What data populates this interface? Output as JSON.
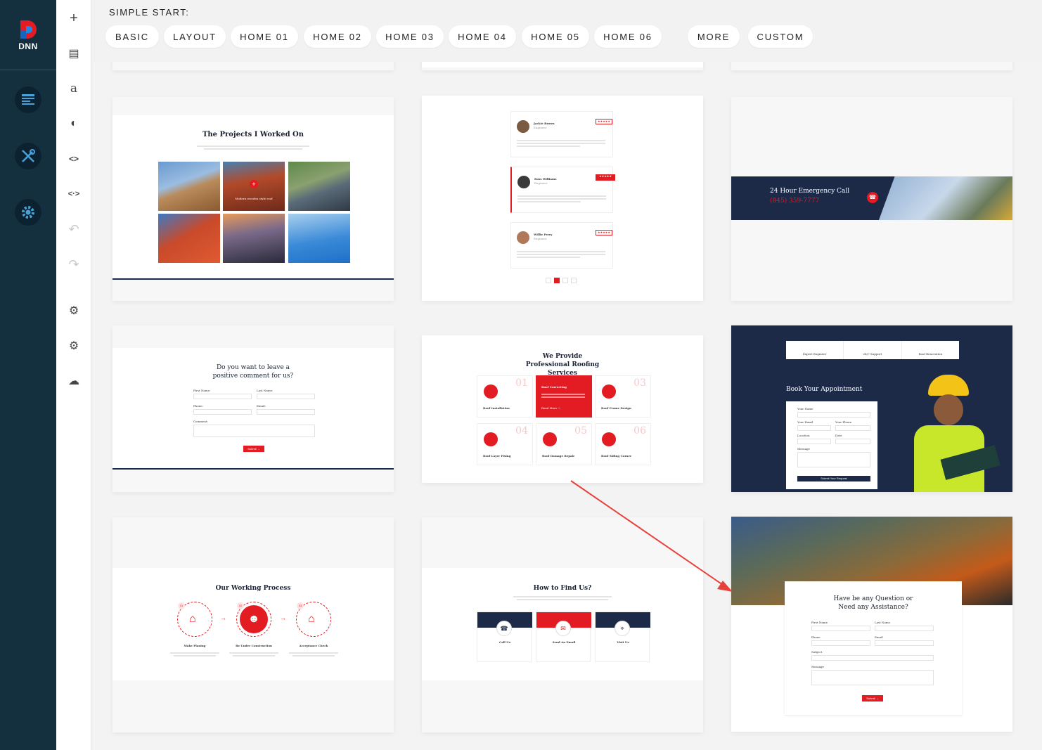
{
  "brand": {
    "logo_text": "DNN",
    "accent": "#e31b23",
    "blue": "#1565c0"
  },
  "sidebar": {
    "items": [
      {
        "icon": "page-icon"
      },
      {
        "icon": "tools-icon"
      },
      {
        "icon": "gear-icon"
      }
    ]
  },
  "toolbar": {
    "items": [
      {
        "icon": "plus-icon",
        "glyph": "+"
      },
      {
        "icon": "document-icon",
        "glyph": "▤"
      },
      {
        "icon": "font-icon",
        "glyph": "a"
      },
      {
        "icon": "contrast-icon",
        "glyph": "◐"
      },
      {
        "icon": "code-icon",
        "glyph": "<>"
      },
      {
        "icon": "resize-icon",
        "glyph": "<·>"
      },
      {
        "icon": "undo-icon",
        "glyph": "↶"
      },
      {
        "icon": "redo-icon",
        "glyph": "↷"
      },
      {
        "icon": "cogs-icon",
        "glyph": "⚙"
      },
      {
        "icon": "settings-icon",
        "glyph": "⚙"
      },
      {
        "icon": "cloud-download-icon",
        "glyph": "☁"
      }
    ]
  },
  "header": {
    "title": "SIMPLE START:",
    "categories": [
      "BASIC",
      "LAYOUT",
      "HOME 01",
      "HOME 02",
      "HOME 03",
      "HOME 04",
      "HOME 05",
      "HOME 06",
      "MORE",
      "CUSTOM"
    ]
  },
  "templates": {
    "projects": {
      "title": "The Projects I Worked On",
      "overlay": "Modern wooden style roof"
    },
    "testimonials": {
      "people": [
        {
          "name": "Jackie Brown",
          "role": "Engineer"
        },
        {
          "name": "Ross Williams",
          "role": "Engineer"
        },
        {
          "name": "Willie Perry",
          "role": "Engineer"
        }
      ],
      "stars": "★★★★★"
    },
    "emergency": {
      "title": "24 Hour Emergency Call",
      "phone": "(845) 359-7777"
    },
    "comment": {
      "title": "Do you want to leave a positive comment for us?",
      "first_name": "First Name:",
      "last_name": "Last Name:",
      "phone": "Phone:",
      "email": "Email:",
      "comment": "Comment:",
      "submit": "Submit →"
    },
    "services": {
      "title": "We Provide Professional Roofing Services",
      "items": [
        {
          "num": "01",
          "label": "Roof Installation"
        },
        {
          "num": "02",
          "label": "Roof Correcting",
          "link": "Read More →"
        },
        {
          "num": "03",
          "label": "Roof Frame Design"
        },
        {
          "num": "04",
          "label": "Roof Layer Fixing"
        },
        {
          "num": "05",
          "label": "Roof Damage Repair"
        },
        {
          "num": "06",
          "label": "Roof Siding Corner"
        }
      ]
    },
    "appointment": {
      "tabs": [
        "Expert Engineer",
        "24/7 Support",
        "Roof Renovation"
      ],
      "title": "Book Your Appointment",
      "name": "Your Name",
      "email": "Your Email",
      "phone": "Your Phone",
      "location": "Location",
      "date": "Date",
      "message": "Message",
      "submit": "Submit Your Request"
    },
    "process": {
      "title": "Our Working Process",
      "steps": [
        {
          "num": "01",
          "label": "Make Planing"
        },
        {
          "num": "02",
          "label": "Be Under Construction"
        },
        {
          "num": "03",
          "label": "Acceptance Check"
        }
      ]
    },
    "find_us": {
      "title": "How to Find Us?",
      "items": [
        {
          "label": "Call Us"
        },
        {
          "label": "Send An Email"
        },
        {
          "label": "Visit Us"
        }
      ]
    },
    "question": {
      "title": "Have be any Question or Need any Assistance?",
      "first_name": "First Name",
      "last_name": "Last Name",
      "phone": "Phone",
      "email": "Email",
      "subject": "Subject",
      "message": "Message",
      "submit": "Submit →"
    }
  }
}
